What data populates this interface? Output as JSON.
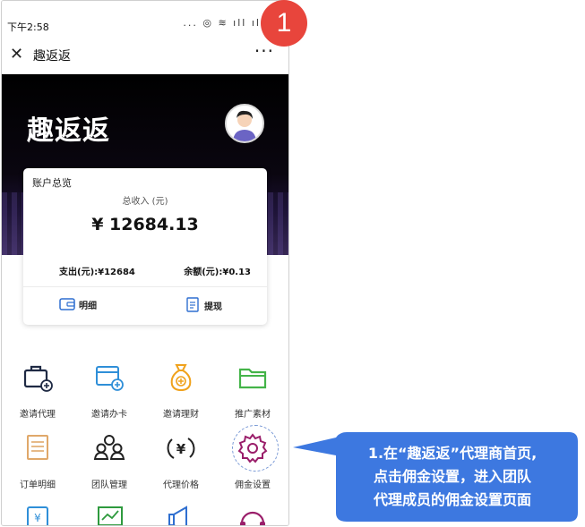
{
  "statusbar": {
    "time": "下午2:58",
    "icons": "... ◎ ≋ ıll ıll"
  },
  "navbar": {
    "close_icon": "close-icon",
    "title": "趣返返",
    "more": "···"
  },
  "hero": {
    "brand": "趣返返"
  },
  "card": {
    "title": "账户总览",
    "income_label": "总收入 (元)",
    "income_value": "¥ 12684.13",
    "expense": "支出(元):¥12684",
    "balance": "余额(元):¥0.13",
    "detail_label": "明细",
    "withdraw_label": "提现"
  },
  "grid": [
    {
      "label": "邀请代理",
      "icon": "briefcase-plus-icon",
      "color": "#1f2a44"
    },
    {
      "label": "邀请办卡",
      "icon": "card-plus-icon",
      "color": "#2f8fd8"
    },
    {
      "label": "邀请理财",
      "icon": "money-bag-icon",
      "color": "#f0a21c"
    },
    {
      "label": "推广素材",
      "icon": "folder-icon",
      "color": "#44b449"
    },
    {
      "label": "订单明细",
      "icon": "order-list-icon",
      "color": "#e0a86a"
    },
    {
      "label": "团队管理",
      "icon": "team-icon",
      "color": "#222222"
    },
    {
      "label": "代理价格",
      "icon": "yuan-refresh-icon",
      "color": "#222222"
    },
    {
      "label": "佣金设置",
      "icon": "gear-icon",
      "color": "#9a1e6a"
    }
  ],
  "badge": "1",
  "callout": {
    "lines": [
      "1.在“趣返返”代理商首页,",
      "点击佣金设置，进入团队",
      "代理成员的佣金设置页面"
    ],
    "color": "#3d78e0"
  }
}
